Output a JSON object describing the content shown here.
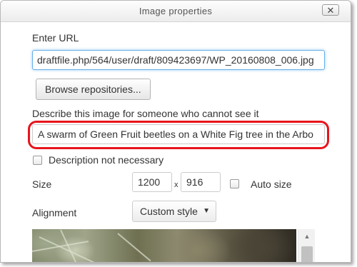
{
  "dialog": {
    "title": "Image properties",
    "close_icon": "close-icon"
  },
  "url": {
    "label": "Enter URL",
    "value": "draftfile.php/564/user/draft/809423697/WP_20160808_006.jpg"
  },
  "browse_button": {
    "label": "Browse repositories..."
  },
  "description": {
    "label": "Describe this image for someone who cannot see it",
    "value": "A swarm of Green Fruit beetles on a White Fig tree in the Arbo"
  },
  "description_not_necessary": {
    "label": "Description not necessary",
    "checked": false
  },
  "size": {
    "label": "Size",
    "width": "1200",
    "separator": "x",
    "height": "916",
    "auto_size_label": "Auto size",
    "auto_size_checked": false
  },
  "alignment": {
    "label": "Alignment",
    "selected": "Custom style",
    "arrow_icon": "caret-down-icon"
  },
  "highlight_color": "#e8141b",
  "focus_color": "#66afe9"
}
